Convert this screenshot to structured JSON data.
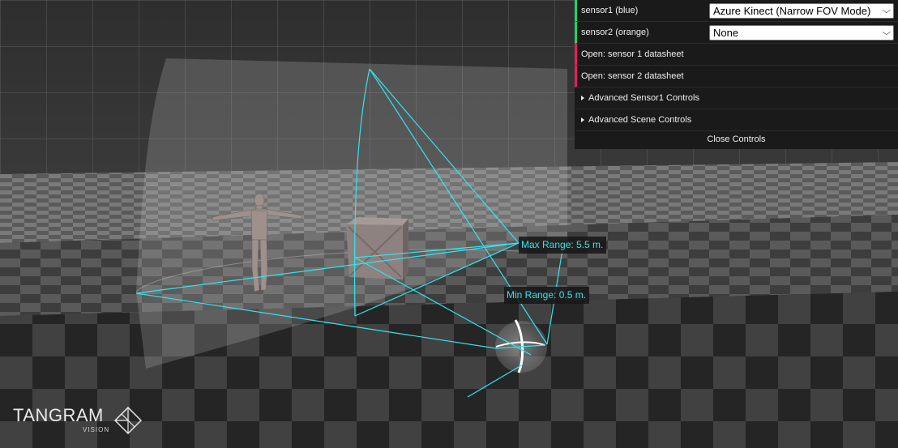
{
  "controls": {
    "sensor1_label": "sensor1 (blue)",
    "sensor1_value": "Azure Kinect (Narrow FOV Mode)",
    "sensor2_label": "sensor2 (orange)",
    "sensor2_value": "None",
    "datasheet1": "Open: sensor 1 datasheet",
    "datasheet2": "Open: sensor 2 datasheet",
    "advanced_sensor1": "Advanced Sensor1 Controls",
    "advanced_scene": "Advanced Scene Controls",
    "close": "Close Controls"
  },
  "overlay": {
    "max_range": "Max Range: 5.5 m.",
    "min_range": "Min Range: 0.5 m."
  },
  "logo": {
    "name": "TANGRAM",
    "sub": "VISION"
  },
  "icons": {
    "select_chevron": "chevron-down-icon",
    "folder_toggle": "triangle-right-icon",
    "logo_mark": "tangram-diamond-icon"
  },
  "colors": {
    "frustum": "#2ee6f0",
    "panel_bg": "#1a1a1a",
    "select_bar": "#1ed36f",
    "link_bar": "#e61d5f"
  }
}
